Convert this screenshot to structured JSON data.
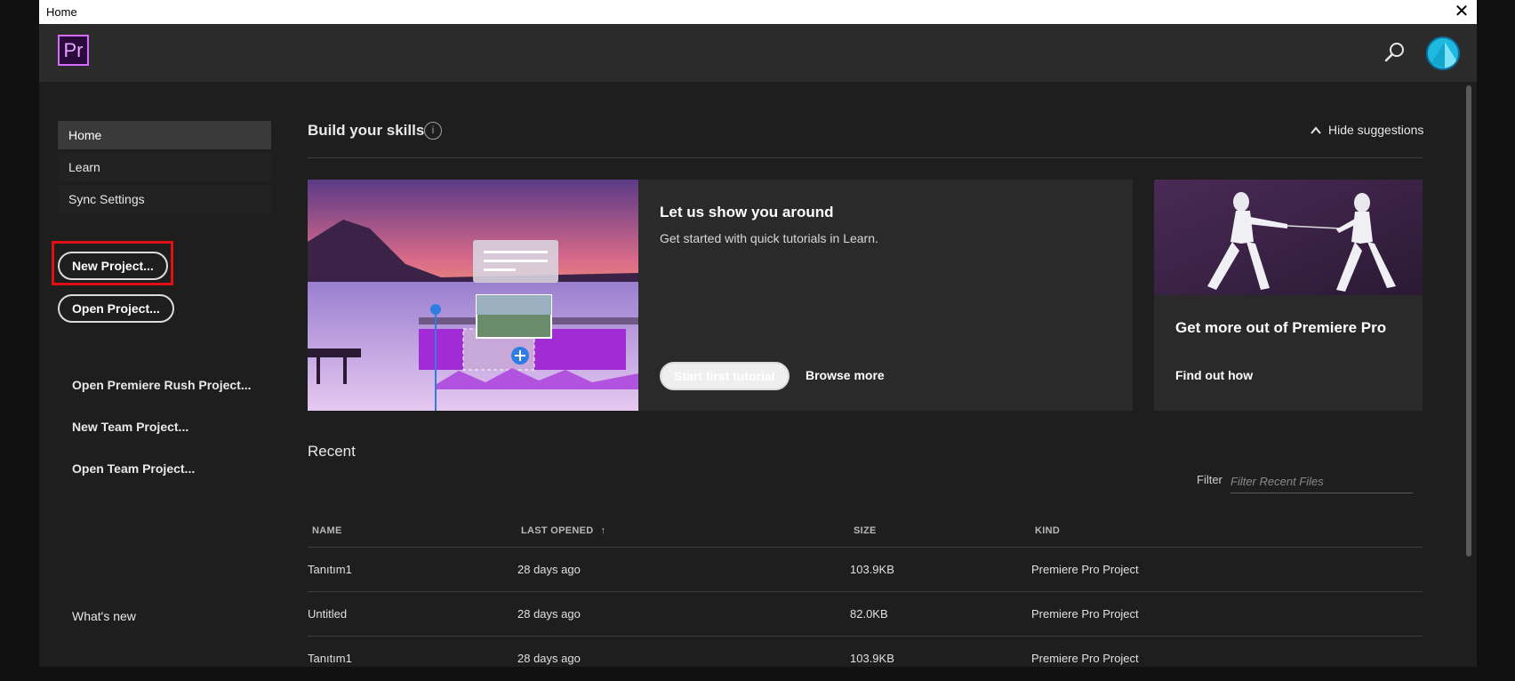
{
  "window": {
    "title": "Home",
    "close_glyph": "✕"
  },
  "topbar": {
    "logo_text": "Pr",
    "search_icon": "search-icon",
    "avatar_icon": "avatar"
  },
  "sidebar": {
    "nav": [
      "Home",
      "Learn",
      "Sync Settings"
    ],
    "new_project": "New Project...",
    "open_project": "Open Project...",
    "links": [
      "Open Premiere Rush Project...",
      "New Team Project...",
      "Open Team Project..."
    ],
    "whats_new": "What's new"
  },
  "skills": {
    "title": "Build your skills",
    "info_glyph": "i",
    "hide_suggestions": "Hide suggestions",
    "main_card": {
      "heading": "Let us show you around",
      "text": "Get started with quick tutorials in Learn.",
      "start_button": "Start first tutorial",
      "browse_link": "Browse more"
    },
    "side_card": {
      "heading": "Get more out of Premiere Pro",
      "link": "Find out how"
    }
  },
  "recent": {
    "title": "Recent",
    "filter_label": "Filter",
    "filter_placeholder": "Filter Recent Files",
    "columns": {
      "name": "NAME",
      "last_opened": "LAST OPENED",
      "size": "SIZE",
      "kind": "KIND"
    },
    "rows": [
      {
        "name": "Tanıtım1",
        "last_opened": "28 days ago",
        "size": "103.9KB",
        "kind": "Premiere Pro Project"
      },
      {
        "name": "Untitled",
        "last_opened": "28 days ago",
        "size": "82.0KB",
        "kind": "Premiere Pro Project"
      },
      {
        "name": "Tanıtım1",
        "last_opened": "28 days ago",
        "size": "103.9KB",
        "kind": "Premiere Pro Project"
      }
    ]
  },
  "colors": {
    "accent_purple": "#d36cff",
    "highlight_red": "#e01010",
    "avatar_cyan": "#1db9de"
  }
}
